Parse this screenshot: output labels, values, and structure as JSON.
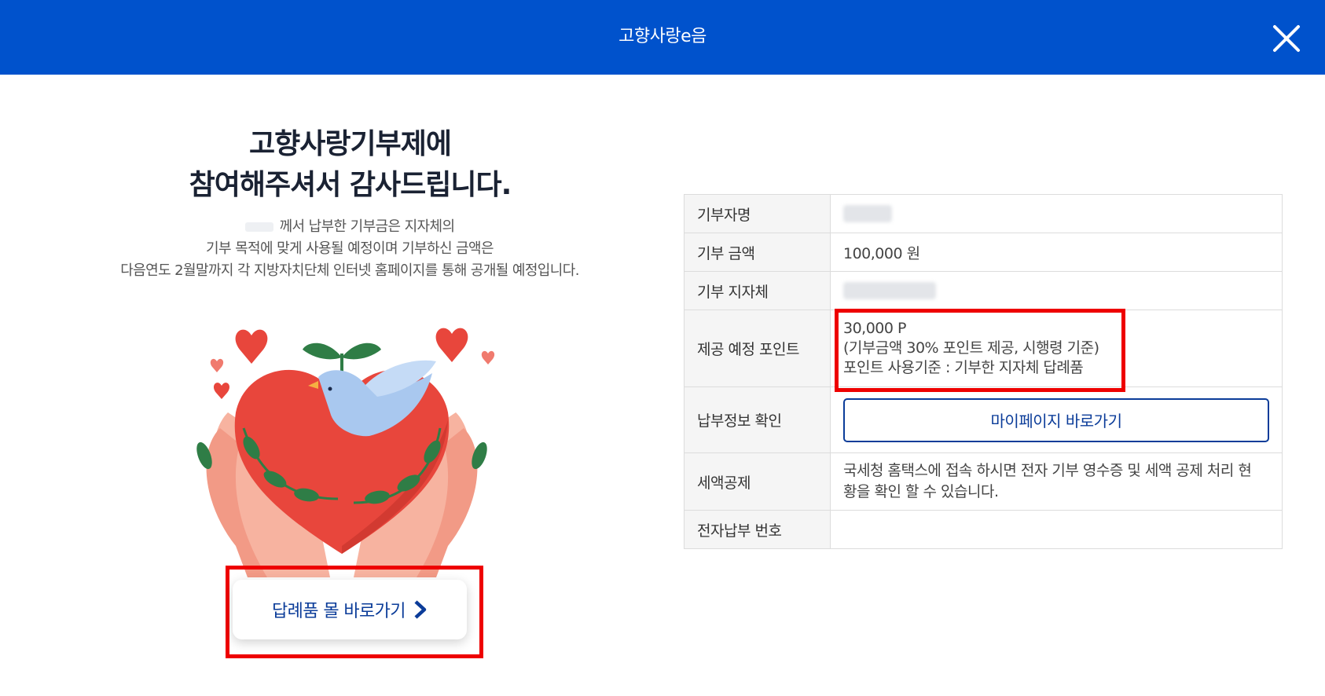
{
  "header": {
    "title": "고향사랑e음",
    "close_icon": "close-icon"
  },
  "main": {
    "thanks_line1": "고향사랑기부제에",
    "thanks_line2": "참여해주셔서 감사드립니다.",
    "desc_line1": "께서 납부한 기부금은 지자체의",
    "desc_line2": "기부 목적에 맞게 사용될 예정이며 기부하신 금액은",
    "desc_line3": "다음연도 2월말까지 각 지방자치단체 인터넷 홈페이지를 통해 공개될 예정입니다.",
    "illustration_icon": "heart-hands-dove-illustration",
    "mall_button_label": "답례품 몰 바로가기",
    "mall_button_icon": "chevron-right-icon"
  },
  "info": {
    "rows": [
      {
        "label": "기부자명",
        "value": ""
      },
      {
        "label": "기부 금액",
        "value": "100,000 원"
      },
      {
        "label": "기부 지자체",
        "value": ""
      },
      {
        "label": "제공 예정 포인트",
        "lines": [
          "30,000 P",
          "(기부금액 30% 포인트 제공, 시행령 기준)",
          "포인트 사용기준 : 기부한 지자체 답례품"
        ]
      },
      {
        "label": "납부정보 확인",
        "button": "마이페이지 바로가기"
      },
      {
        "label": "세액공제",
        "lines": [
          "국세청 홈택스에 접속 하시면 전자 기부 영수증 및 세액 공제 처리 현",
          "황을 확인 할 수 있습니다."
        ]
      },
      {
        "label": "전자납부 번호",
        "value": ""
      }
    ]
  },
  "colors": {
    "header_bg": "#0052cc",
    "accent_dark_blue": "#0b3c99",
    "highlight_red": "#ee0000",
    "heart_red": "#e8463c"
  }
}
